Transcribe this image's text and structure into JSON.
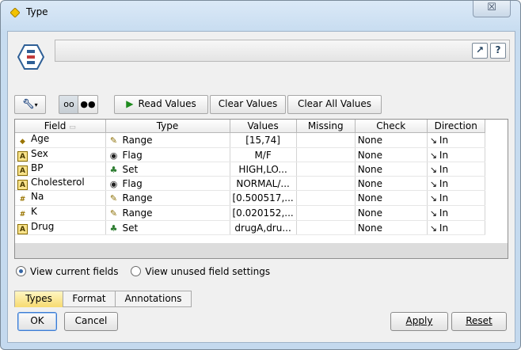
{
  "window": {
    "title": "Type",
    "close_glyph": "☒",
    "accent": "#f2c200"
  },
  "header": {
    "help_glyph": "?",
    "goto_glyph": "↗"
  },
  "toolbar": {
    "read_values": "Read Values",
    "clear_values": "Clear Values",
    "clear_all_values": "Clear All Values"
  },
  "table": {
    "columns": [
      "Field",
      "Type",
      "Values",
      "Missing",
      "Check",
      "Direction"
    ],
    "rows": [
      {
        "field": "Age",
        "field_icon": "range-field-icon",
        "type": "Range",
        "type_icon": "ruler-icon",
        "values": "[15,74]",
        "missing": "",
        "check": "None",
        "direction": "In"
      },
      {
        "field": "Sex",
        "field_icon": "string-field-icon",
        "type": "Flag",
        "type_icon": "flag-icon",
        "values": "M/F",
        "missing": "",
        "check": "None",
        "direction": "In"
      },
      {
        "field": "BP",
        "field_icon": "string-field-icon",
        "type": "Set",
        "type_icon": "set-icon",
        "values": "HIGH,LO...",
        "missing": "",
        "check": "None",
        "direction": "In"
      },
      {
        "field": "Cholesterol",
        "field_icon": "string-field-icon",
        "type": "Flag",
        "type_icon": "flag-icon",
        "values": "NORMAL/...",
        "missing": "",
        "check": "None",
        "direction": "In"
      },
      {
        "field": "Na",
        "field_icon": "real-field-icon",
        "type": "Range",
        "type_icon": "ruler-icon",
        "values": "[0.500517,...",
        "missing": "",
        "check": "None",
        "direction": "In"
      },
      {
        "field": "K",
        "field_icon": "real-field-icon",
        "type": "Range",
        "type_icon": "ruler-icon",
        "values": "[0.020152,...",
        "missing": "",
        "check": "None",
        "direction": "In"
      },
      {
        "field": "Drug",
        "field_icon": "string-field-icon",
        "type": "Set",
        "type_icon": "set-icon",
        "values": "drugA,dru...",
        "missing": "",
        "check": "None",
        "direction": "In"
      }
    ]
  },
  "view_options": {
    "current": "View current fields",
    "unused": "View unused field settings",
    "selected": "current"
  },
  "tabs": [
    "Types",
    "Format",
    "Annotations"
  ],
  "selected_tab": "Types",
  "buttons": {
    "ok": "OK",
    "cancel": "Cancel",
    "apply": "Apply",
    "reset": "Reset"
  }
}
